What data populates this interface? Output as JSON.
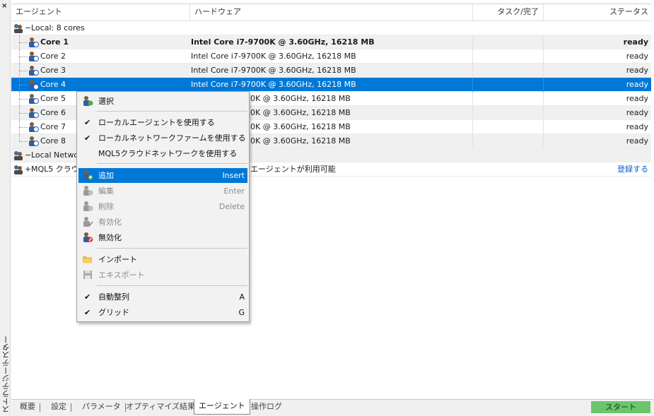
{
  "side": {
    "close_label": "×",
    "vertical_title": "ストラテジーテスター"
  },
  "header": {
    "col_agent": "エージェント",
    "col_hardware": "ハードウェア",
    "col_task": "タスク/完了",
    "col_status": "ステータス"
  },
  "groups": {
    "local": {
      "label": "Local: 8 cores",
      "expander": "−"
    },
    "local_network": {
      "label": "Local Netwo",
      "expander": "−"
    },
    "mql5": {
      "label": "MQL5 クラウ",
      "expander": "+",
      "text": "エージェントが利用可能",
      "action": "登録する"
    }
  },
  "rows": [
    {
      "name": "Core 1",
      "hardware": "Intel Core i7-9700K  @ 3.60GHz, 16218 MB",
      "status": "ready"
    },
    {
      "name": "Core 2",
      "hardware": "Intel Core i7-9700K  @ 3.60GHz, 16218 MB",
      "status": "ready"
    },
    {
      "name": "Core 3",
      "hardware": "Intel Core i7-9700K  @ 3.60GHz, 16218 MB",
      "status": "ready"
    },
    {
      "name": "Core 4",
      "hardware": "Intel Core i7-9700K  @ 3.60GHz, 16218 MB",
      "status": "ready"
    },
    {
      "name": "Core 5",
      "hardware": "0K  @ 3.60GHz, 16218 MB",
      "status": "ready"
    },
    {
      "name": "Core 6",
      "hardware": "0K  @ 3.60GHz, 16218 MB",
      "status": "ready"
    },
    {
      "name": "Core 7",
      "hardware": "0K  @ 3.60GHz, 16218 MB",
      "status": "ready"
    },
    {
      "name": "Core 8",
      "hardware": "0K  @ 3.60GHz, 16218 MB",
      "status": "ready"
    }
  ],
  "menu": {
    "select": "選択",
    "use_local": "ローカルエージェントを使用する",
    "use_network": "ローカルネットワークファームを使用する",
    "use_cloud": "MQL5クラウドネットワークを使用する",
    "add": "追加",
    "add_sc": "Insert",
    "edit": "編集",
    "edit_sc": "Enter",
    "delete": "削除",
    "delete_sc": "Delete",
    "enable": "有効化",
    "disable": "無効化",
    "import": "インポート",
    "export": "エキスポート",
    "auto_arrange": "自動整列",
    "auto_arrange_sc": "A",
    "grid": "グリッド",
    "grid_sc": "G",
    "check": "✔"
  },
  "tabs": [
    "概要",
    "設定",
    "パラメータ",
    "オプティマイズ結果",
    "エージェント",
    "操作ログ"
  ],
  "start_label": "スタート",
  "colors": {
    "selection": "#0078d7",
    "start": "#6cc56c",
    "link": "#0a5ccf"
  }
}
